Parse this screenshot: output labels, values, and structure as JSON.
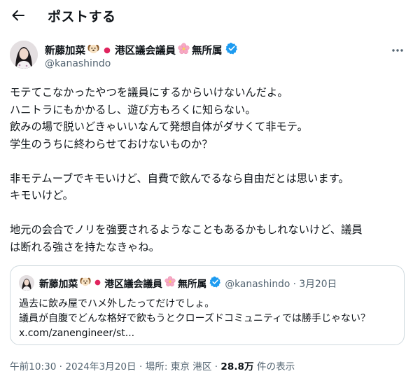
{
  "header": {
    "title": "ポストする"
  },
  "author": {
    "name": "新藤加菜",
    "name_suffix": "港区議会議員",
    "affiliation": "無所属",
    "handle": "@kanashindo"
  },
  "tweet": {
    "paragraphs": [
      [
        "モテてこなかったやつを議員にするからいけないんだよ。",
        "ハニトラにもかかるし、遊び方もろくに知らない。",
        "飲みの場で脱いどきゃいいなんて発想自体がダサくて非モテ。",
        "学生のうちに終わらせておけないものか？"
      ],
      [
        "非モテムーブでキモいけど、自費で飲んでるなら自由だとは思います。",
        "キモいけど。"
      ],
      [
        "地元の会合でノリを強要されるようなこともあるかもしれないけど、議員",
        "は断れる強さを持たなきゃね。"
      ]
    ]
  },
  "quote": {
    "name": "新藤加菜",
    "name_suffix": "港区議会議員",
    "affiliation": "無所属",
    "handle_date": "@kanashindo · 3月20日",
    "lines": [
      "過去に飲み屋でハメ外したってだけでしょ。",
      "議員が自腹でどんな格好で飲もうとクローズドコミュニティでは勝手じゃない？",
      "x.com/zanengineer/st..."
    ]
  },
  "meta": {
    "timestamp": "午前10:30 · 2024年3月20日",
    "location": "場所: 東京 港区",
    "views_count": "28.8万",
    "views_label": "件の表示"
  },
  "icons": {
    "back": "arrow-left-icon",
    "more": "more-horizontal-icon",
    "verified": "verified-badge-icon",
    "dog": "dog-face-emoji",
    "flag": "japan-flag-emoji",
    "blossom": "cherry-blossom-emoji"
  },
  "colors": {
    "verified": "#1d9bf0",
    "secondary_text": "#536471",
    "border": "#cfd9de",
    "flag_red": "#e0245e"
  }
}
